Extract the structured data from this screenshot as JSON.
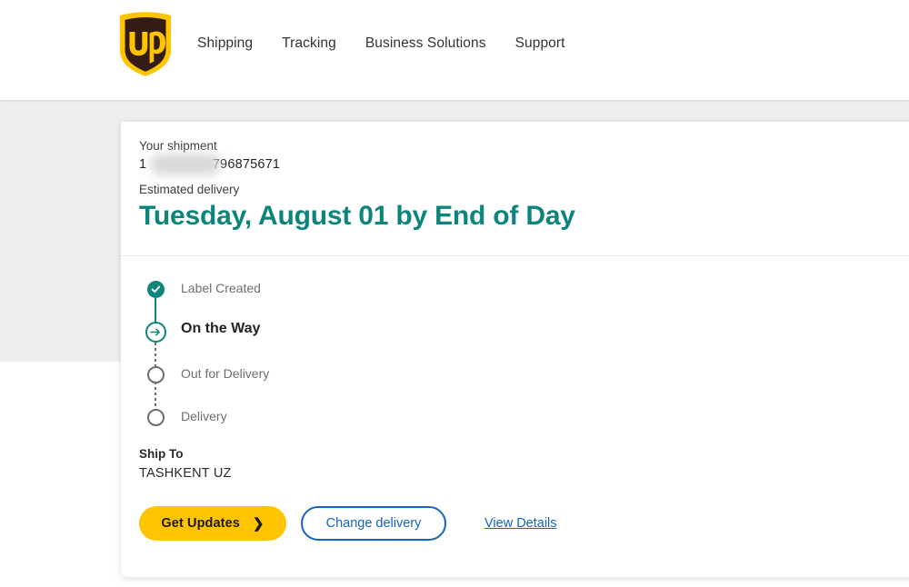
{
  "header": {
    "logo_alt": "UPS",
    "logo_text": "ups",
    "nav": [
      {
        "label": "Shipping"
      },
      {
        "label": "Tracking"
      },
      {
        "label": "Business Solutions"
      },
      {
        "label": "Support"
      }
    ]
  },
  "card": {
    "shipment_label": "Your shipment",
    "tracking_prefix": "1",
    "tracking_suffix": "796875671",
    "estimated_label": "Estimated delivery",
    "eta": "Tuesday, August 01 by End of Day",
    "progress": [
      {
        "label": "Label Created",
        "state": "done"
      },
      {
        "label": "On the Way",
        "state": "current"
      },
      {
        "label": "Out for Delivery",
        "state": "future"
      },
      {
        "label": "Delivery",
        "state": "future"
      }
    ],
    "ship_to_label": "Ship To",
    "ship_to_value": "TASHKENT UZ",
    "actions": {
      "primary_label": "Get Updates",
      "primary_chevron": "❯",
      "secondary_label": "Change delivery",
      "details_link": "View Details"
    }
  },
  "colors": {
    "ups_gold": "#ffc400",
    "ups_brown": "#341b14",
    "teal": "#0d857b",
    "blue": "#1464c0",
    "grey_band": "#efeeec",
    "muted_text": "#6f6f6f"
  }
}
